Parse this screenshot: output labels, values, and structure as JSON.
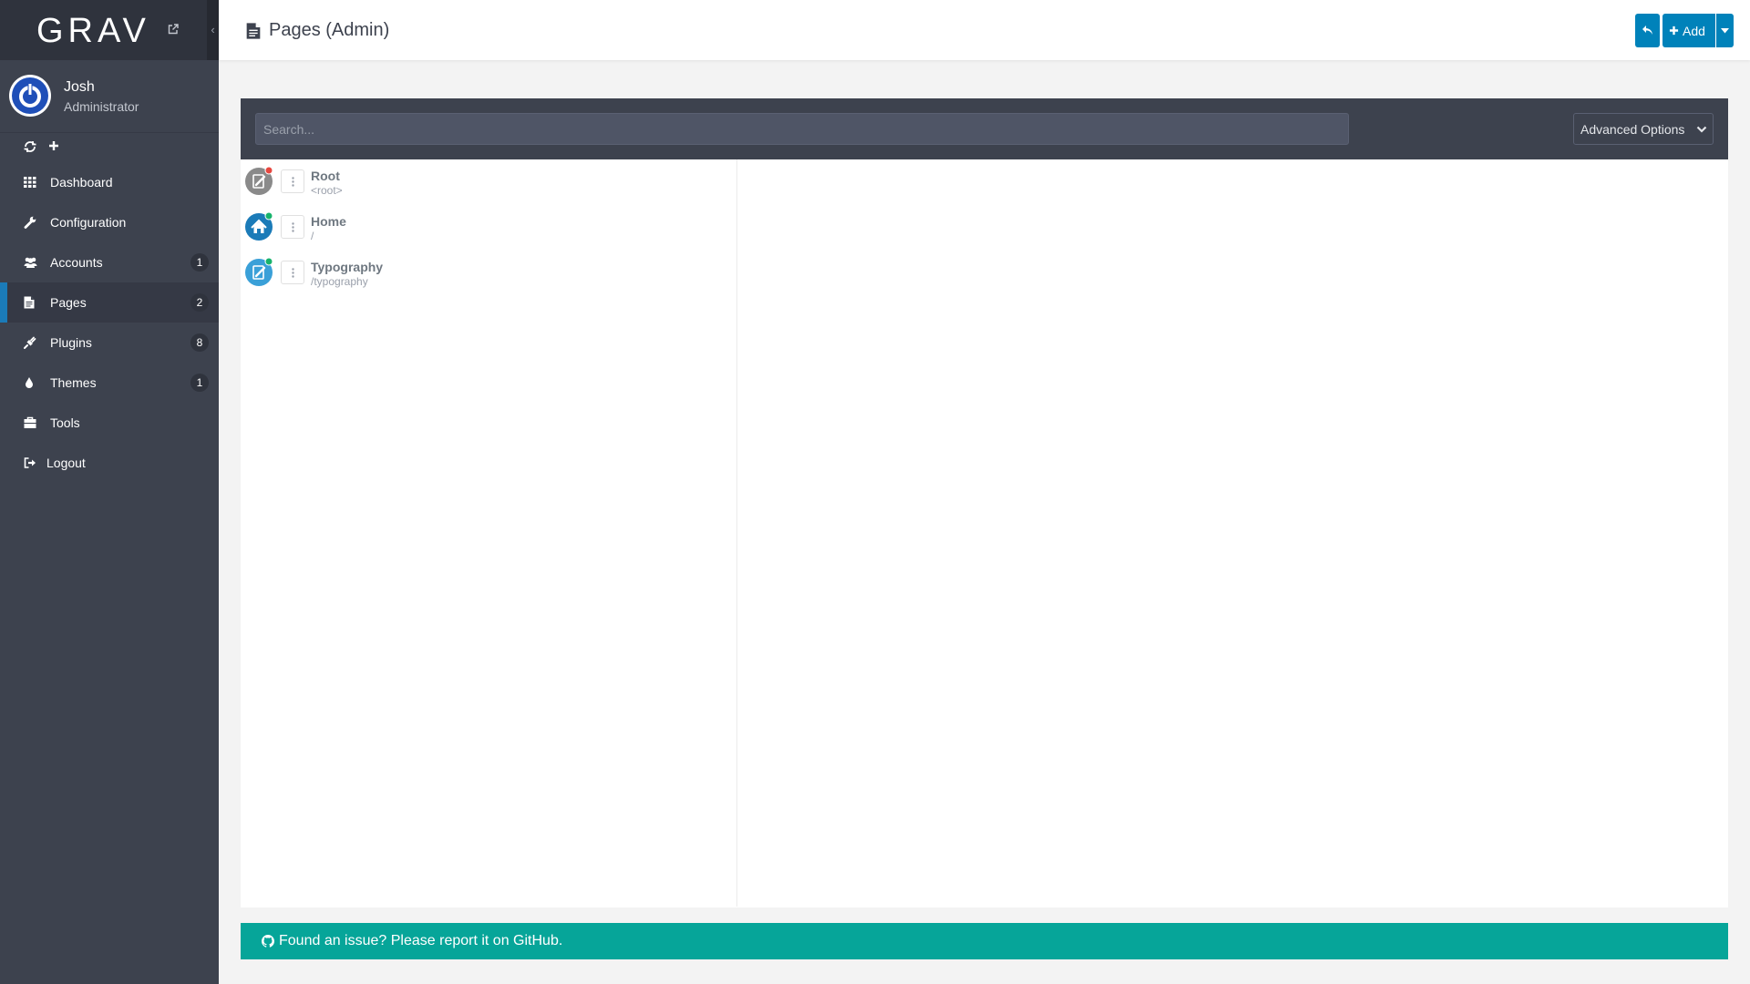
{
  "brand": {
    "logo_text": "GRAV"
  },
  "user": {
    "name": "Josh",
    "role": "Administrator"
  },
  "nav": [
    {
      "label": "Dashboard",
      "icon": "dashboard-icon"
    },
    {
      "label": "Configuration",
      "icon": "wrench-icon"
    },
    {
      "label": "Accounts",
      "icon": "users-icon",
      "badge": "1"
    },
    {
      "label": "Pages",
      "icon": "file-icon",
      "badge": "2",
      "active": true
    },
    {
      "label": "Plugins",
      "icon": "plug-icon",
      "badge": "8"
    },
    {
      "label": "Themes",
      "icon": "tint-icon",
      "badge": "1"
    },
    {
      "label": "Tools",
      "icon": "toolbox-icon"
    },
    {
      "label": "Logout",
      "icon": "sign-out-icon"
    }
  ],
  "header": {
    "title": "Pages (Admin)",
    "add_label": "Add"
  },
  "filter": {
    "search_placeholder": "Search...",
    "advanced_label": "Advanced Options"
  },
  "pages": [
    {
      "title": "Root",
      "route": "<root>",
      "status": "unpublished",
      "status_color": "#e7473f",
      "icon_color": "#8a8a8a"
    },
    {
      "title": "Home",
      "route": "/",
      "status": "published",
      "status_color": "#17b36c",
      "icon_color": "#1b7bb8"
    },
    {
      "title": "Typography",
      "route": "/typography",
      "status": "published",
      "status_color": "#17b36c",
      "icon_color": "#3aa0d8"
    }
  ],
  "footer": {
    "notice": "Found an issue? Please report it on GitHub."
  },
  "colors": {
    "sidebar": "#3d424e",
    "accent": "#0082ba",
    "notice": "#06a599"
  }
}
